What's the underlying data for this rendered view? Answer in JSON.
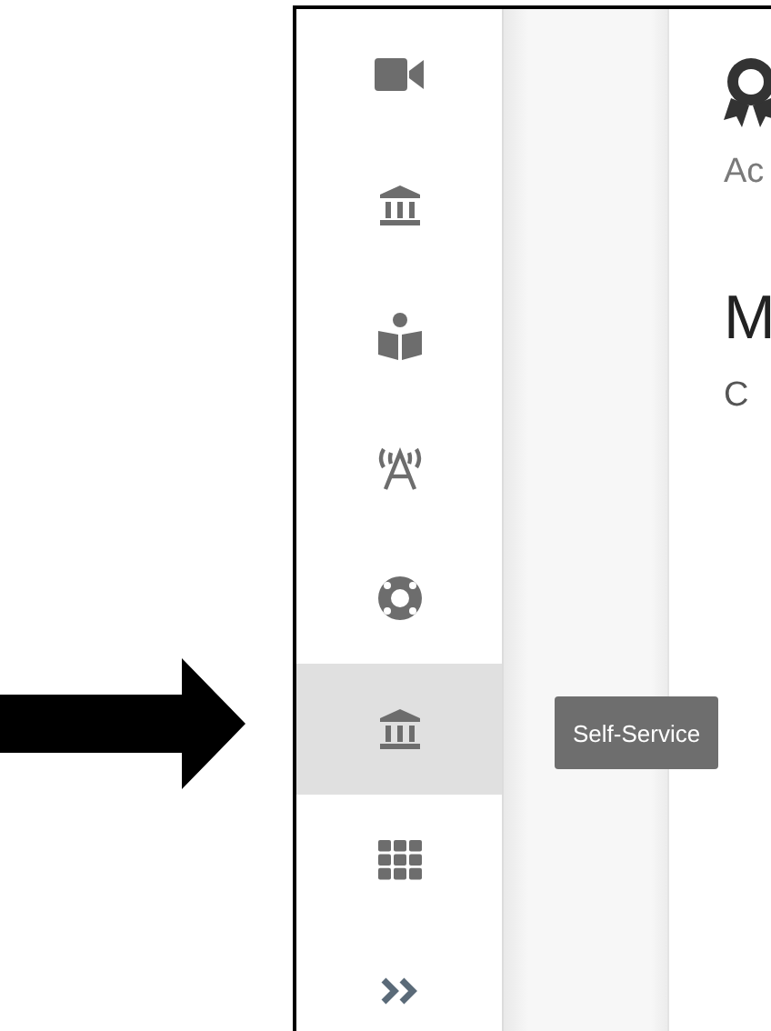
{
  "sidebar": {
    "items": [
      {
        "kind": "video",
        "selected": false
      },
      {
        "kind": "bank",
        "selected": false
      },
      {
        "kind": "reader",
        "selected": false
      },
      {
        "kind": "antenna",
        "selected": false
      },
      {
        "kind": "lifebuoy",
        "selected": false
      },
      {
        "kind": "bank",
        "selected": true
      },
      {
        "kind": "grid",
        "selected": false
      },
      {
        "kind": "expand",
        "selected": false
      }
    ]
  },
  "tooltip": {
    "text": "Self-Service"
  },
  "content": {
    "subtitle": "Ac",
    "heading": "M",
    "subheading": "C"
  }
}
